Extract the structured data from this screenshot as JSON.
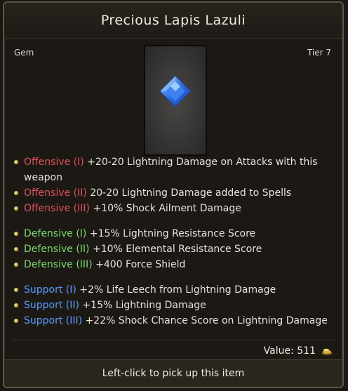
{
  "item": {
    "title": "Precious Lapis Lazuli",
    "type": "Gem",
    "tier": "Tier 7",
    "gem_color": "#2f6fe0"
  },
  "mods": {
    "offensive": [
      {
        "label": "Offensive (I)",
        "text": " +20-20 Lightning Damage on Attacks with this weapon"
      },
      {
        "label": "Offensive (II)",
        "text": " 20-20 Lightning Damage added to Spells"
      },
      {
        "label": "Offensive (III)",
        "text": " +10% Shock Ailment Damage"
      }
    ],
    "defensive": [
      {
        "label": "Defensive (I)",
        "text": " +15% Lightning Resistance Score"
      },
      {
        "label": "Defensive (II)",
        "text": " +10% Elemental Resistance Score"
      },
      {
        "label": "Defensive (III)",
        "text": " +400 Force Shield"
      }
    ],
    "support": [
      {
        "label": "Support (I)",
        "text": " +2% Life Leech from Lightning Damage"
      },
      {
        "label": "Support (II)",
        "text": " +15% Lightning Damage"
      },
      {
        "label": "Support (III)",
        "text": " +22% Shock Chance Score on Lightning Damage"
      }
    ]
  },
  "colors": {
    "offensive": "#e0515a",
    "defensive": "#7bdc6f",
    "support": "#5a9cff"
  },
  "value": {
    "text": "Value: 511",
    "icon": "coin-pile-icon"
  },
  "footer": {
    "hint": "Left-click to pick up this item"
  }
}
